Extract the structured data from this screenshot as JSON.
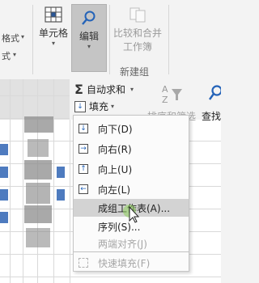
{
  "ribbon": {
    "cut_top": "格式",
    "cut_bottom": "式",
    "cells_label": "单元格",
    "edit_label": "编辑",
    "merge_label_line1": "比较和合并",
    "merge_label_line2": "工作簿",
    "group_title": "新建组"
  },
  "editing": {
    "autosum_label": "自动求和",
    "fill_label": "填充",
    "sort_filter_label": "排序和筛选",
    "find_label": "查找"
  },
  "fill_menu": {
    "items": [
      {
        "label": "向下(D)",
        "icon": "arrow-down-icon",
        "enabled": true
      },
      {
        "label": "向右(R)",
        "icon": "arrow-right-icon",
        "enabled": true
      },
      {
        "label": "向上(U)",
        "icon": "arrow-up-icon",
        "enabled": true
      },
      {
        "label": "向左(L)",
        "icon": "arrow-left-icon",
        "enabled": true
      },
      {
        "label": "成组工作表(A)...",
        "icon": "",
        "enabled": true,
        "highlighted": true
      },
      {
        "label": "序列(S)...",
        "icon": "",
        "enabled": true
      },
      {
        "label": "两端对齐(J)",
        "icon": "",
        "enabled": false
      },
      {
        "label": "快速填充(F)",
        "icon": "flash-fill-icon",
        "enabled": false
      }
    ]
  },
  "colors": {
    "ribbon_bg": "#f3f3f3",
    "pressed_button": "#c5c5c5",
    "menu_highlight": "#d3d3d3",
    "icon_blue": "#2463b8"
  }
}
